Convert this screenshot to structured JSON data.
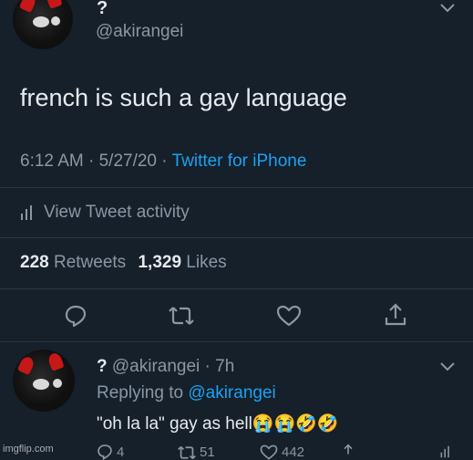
{
  "tweet": {
    "display_name": "?",
    "handle": "@akirangei",
    "text": "french is such a gay language",
    "time": "6:12 AM",
    "date": "5/27/20",
    "source": "Twitter for iPhone",
    "sep": "·",
    "view_activity": "View Tweet activity",
    "retweet_count": "228",
    "retweet_label": "Retweets",
    "like_count": "1,329",
    "like_label": "Likes"
  },
  "reply": {
    "display_name": "?",
    "handle_time": "@akirangei · 7h",
    "replying_prefix": "Replying to",
    "replying_handle": "@akirangei",
    "text": "\"oh la la\" gay as hell",
    "emoji": "😭😭🤣🤣",
    "reply_count": "4",
    "retweet_count": "51",
    "like_count": "442"
  },
  "watermark": "imgflip.com",
  "colors": {
    "background": "#15202b",
    "link": "#1da1f2",
    "muted": "#8a97a4",
    "divider": "#2b3642"
  }
}
